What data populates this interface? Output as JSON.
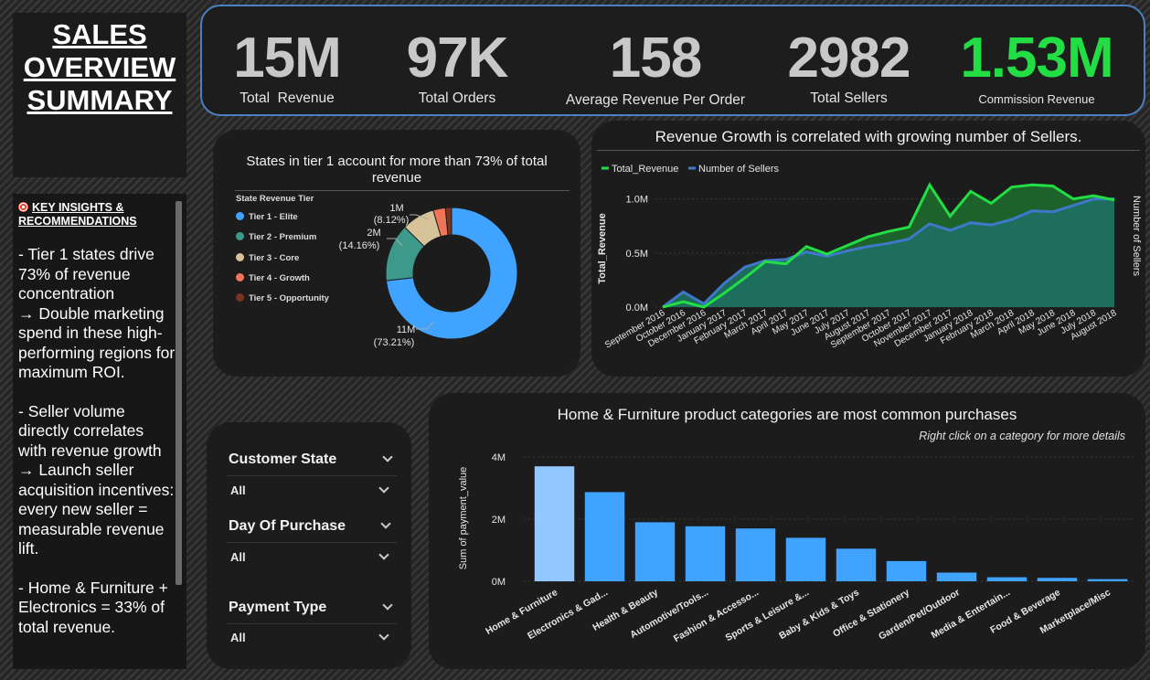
{
  "title": "SALES OVERVIEW SUMMARY",
  "title_lines": [
    "SALES",
    "OVERVIEW",
    "SUMMARY"
  ],
  "insights": {
    "heading": "KEY INSIGHTS & RECOMMENDATIONS",
    "paragraphs": [
      "- Tier 1 states drive 73% of revenue concentration\n  → Double marketing spend in these high-performing regions for maximum ROI.",
      "- Seller volume directly correlates with revenue growth\n  → Launch seller acquisition incentives: every new seller = measurable revenue lift.",
      "- Home & Furniture + Electronics = 33% of total revenue."
    ]
  },
  "kpis": [
    {
      "value": "15M",
      "label": "Total  Revenue",
      "color": "#c8c8c8"
    },
    {
      "value": "97K",
      "label": "Total Orders",
      "color": "#c8c8c8"
    },
    {
      "value": "158",
      "label": "Average Revenue Per Order",
      "color": "#c8c8c8"
    },
    {
      "value": "2982",
      "label": "Total Sellers",
      "color": "#c8c8c8"
    },
    {
      "value": "1.53M",
      "label": "Commission Revenue",
      "color": "#22dd44"
    }
  ],
  "filters": [
    {
      "label": "Customer State",
      "value": "All"
    },
    {
      "label": "Day Of Purchase",
      "value": "All"
    },
    {
      "label": "Payment Type",
      "value": "All"
    }
  ],
  "colors": {
    "accent_blue": "#3fa3ff",
    "green": "#22dd44",
    "kpi_border": "#4a7fc1"
  },
  "chart_data": [
    {
      "type": "pie",
      "title": "States in tier 1 account for more than 73% of total revenue",
      "legend_title": "State Revenue Tier",
      "legend_placement": "left",
      "categories": [
        "Tier 1 - Elite",
        "Tier 2 - Premium",
        "Tier 3 - Core",
        "Tier 4 - Growth",
        "Tier 5 - Opportunity"
      ],
      "values": [
        73.21,
        14.16,
        8.12,
        3.0,
        1.51
      ],
      "colors": [
        "#3fa3ff",
        "#3d9a8b",
        "#d7c39a",
        "#ef7458",
        "#7a3520"
      ],
      "data_labels": [
        {
          "value": "11M",
          "percent": "(73.21%)"
        },
        {
          "value": "2M",
          "percent": "(14.16%)"
        },
        {
          "value": "1M",
          "percent": "(8.12%)"
        }
      ]
    },
    {
      "type": "area",
      "title": "Revenue Growth is correlated with growing number of Sellers.",
      "ylabel": "Total_Revenue",
      "y2label": "Number of Sellers",
      "legend_placement": "top-left",
      "yticks": [
        "0.0M",
        "0.5M",
        "1.0M"
      ],
      "ylim": [
        0,
        1.2
      ],
      "x": [
        "September 2016",
        "October 2016",
        "December 2016",
        "January 2017",
        "February 2017",
        "March 2017",
        "April 2017",
        "May 2017",
        "June 2017",
        "July 2017",
        "August 2017",
        "September 2017",
        "October 2017",
        "November 2017",
        "December 2017",
        "January 2018",
        "February 2018",
        "March 2018",
        "April 2018",
        "May 2018",
        "June 2018",
        "July 2018",
        "August 2018"
      ],
      "series": [
        {
          "name": "Total_Revenue",
          "color": "#22dd44",
          "values": [
            0.0,
            0.05,
            0.0,
            0.13,
            0.27,
            0.42,
            0.4,
            0.56,
            0.49,
            0.57,
            0.65,
            0.7,
            0.74,
            1.13,
            0.84,
            1.07,
            0.96,
            1.11,
            1.13,
            1.12,
            1.0,
            1.03,
            0.99
          ]
        },
        {
          "name": "Number of Sellers",
          "color": "#3e78c8",
          "values": [
            0.0,
            0.14,
            0.03,
            0.22,
            0.37,
            0.43,
            0.44,
            0.51,
            0.47,
            0.52,
            0.56,
            0.59,
            0.63,
            0.77,
            0.71,
            0.78,
            0.76,
            0.81,
            0.89,
            0.88,
            0.94,
            1.0,
            1.0
          ]
        }
      ]
    },
    {
      "type": "bar",
      "title": "Home & Furniture product categories are most common purchases",
      "subtitle": "Right click on a category for more details",
      "ylabel": "Sum of payment_value",
      "yticks": [
        "0M",
        "2M",
        "4M"
      ],
      "ylim": [
        0,
        4
      ],
      "categories": [
        "Home & Furniture",
        "Electronics & Gad...",
        "Health & Beauty",
        "Automotive/Tools...",
        "Fashion & Accesso...",
        "Sports & Leisure &...",
        "Baby & Kids & Toys",
        "Office & Stationery",
        "Garden/Pet/Outdoor",
        "Media & Entertain...",
        "Food & Beverage",
        "Marketplace/Misc"
      ],
      "values": [
        3.7,
        2.87,
        1.9,
        1.77,
        1.7,
        1.4,
        1.05,
        0.65,
        0.28,
        0.13,
        0.11,
        0.07
      ],
      "colors": [
        "#92c8ff",
        "#3fa3ff"
      ]
    }
  ]
}
